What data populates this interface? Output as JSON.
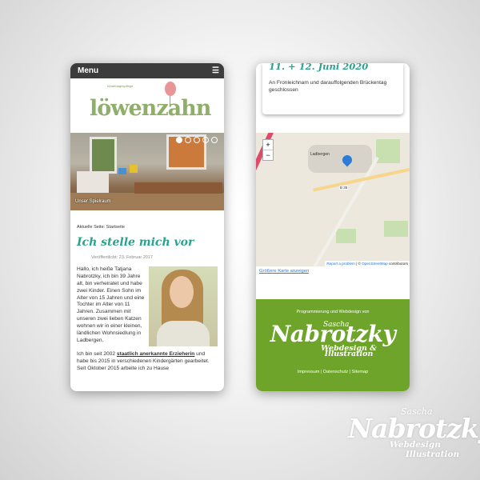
{
  "left": {
    "menu": {
      "label": "Menu",
      "icon": "hamburger-icon"
    },
    "logo": {
      "subtitle": "Kindertagespflege",
      "name": "löwenzahn"
    },
    "slider": {
      "caption": "Unser Spielraum",
      "slide_count": 5,
      "active_slide": 1
    },
    "breadcrumb": "Aktuelle Seite:  Startseite",
    "title": "Ich stelle mich vor",
    "published": "Veröffentlicht: 23. Februar 2017",
    "intro": "Hallo, ich heiße Tatjana Nabrotzky, ich bin 39 Jahre alt, bin verheiratet und habe zwei Kinder. Einen Sohn im Alter von 15 Jahren und eine Tochter im Alter von 11 Jahren. Zusammen mit unseren zwei lieben Katzen wohnen wir in einer kleinen, ländlichen Wohnsiedlung in Ladbergen.",
    "para2_before": "Ich bin seit 2002 ",
    "para2_link": "staatlich anerkannte Erzieherin",
    "para2_after": " und habe bis 2015 in verschiedenen Kindergärten gearbeitet. Seit Oktober 2015 arbeite ich zu Hause"
  },
  "right": {
    "date_title": "11. + 12. Juni 2020",
    "date_text": "An Fronleichnam und darauffolgenden Brückentag geschlossen",
    "map": {
      "zoom_in": "+",
      "zoom_out": "−",
      "town": "Ladbergen",
      "road": "B 35",
      "attribution_link": "Report a problem",
      "attribution_mid": " | © ",
      "attribution_osm": "OpenStreetMap",
      "attribution_end": " contributors"
    },
    "bigger_map": "Größere Karte anzeigen",
    "footer": {
      "prog": "Programmierung und Webdesign von",
      "first": "Sascha",
      "last": "Nabrotzky",
      "sub1": "Webdesign &",
      "sub2": "Illustration",
      "links": "Impressum | Datenschutz | Sitemap"
    }
  },
  "watermark": {
    "first": "Sascha",
    "last": "Nabrotzky",
    "sub1": "Webdesign",
    "sub2": "Illustration"
  },
  "colors": {
    "accent": "#2aa28e",
    "footer_green": "#6ea42a",
    "menubar": "#3c3c3c",
    "link": "#2c7bd6"
  }
}
